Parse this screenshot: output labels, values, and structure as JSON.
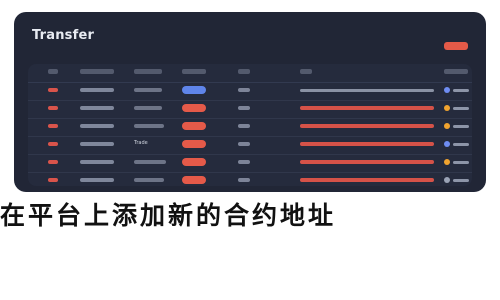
{
  "window": {
    "title": "Transfer"
  },
  "table": {
    "rows": [
      {
        "label": ""
      },
      {
        "label": ""
      },
      {
        "label": ""
      },
      {
        "label": "Trade"
      },
      {
        "label": ""
      },
      {
        "label": ""
      }
    ]
  },
  "footer": {
    "text": "在平台上添加新的合约地址"
  },
  "colors": {
    "accent_red": "#e55a49",
    "accent_blue": "#5f85ea",
    "status_orange": "#f0a32f",
    "status_blue": "#6f8df2"
  },
  "icons": {
    "status": "status-dot-icon",
    "action": "action-pill"
  }
}
